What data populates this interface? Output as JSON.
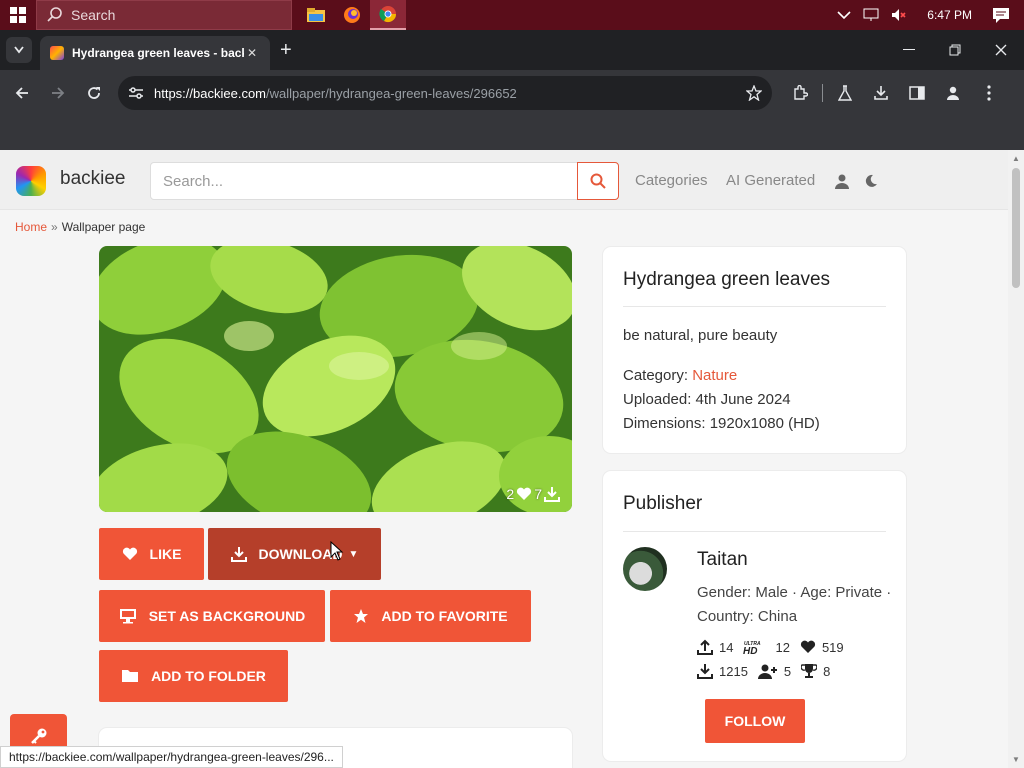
{
  "taskbar": {
    "search_label": "Search",
    "time": "6:47 PM",
    "apps": [
      "file-explorer-icon",
      "firefox-icon",
      "chrome-icon"
    ]
  },
  "browser": {
    "tab_title": "Hydrangea green leaves - backiee",
    "tab_close": "✕",
    "url_host": "https://backiee.com",
    "url_path": "/wallpaper/hydrangea-green-leaves/296652",
    "status_url": "https://backiee.com/wallpaper/hydrangea-green-leaves/296..."
  },
  "site": {
    "logo_text": "backiee",
    "search_placeholder": "Search...",
    "nav": [
      "Categories",
      "AI Generated"
    ],
    "accent_color": "#f05537"
  },
  "breadcrumb": {
    "home": "Home",
    "separator": "»",
    "current": "Wallpaper page"
  },
  "wallpaper": {
    "likes": "2",
    "downloads": "7"
  },
  "actions": {
    "like": "LIKE",
    "download": "DOWNLOAD",
    "set_background": "SET AS BACKGROUND",
    "add_favorite": "ADD TO FAVORITE",
    "add_folder": "ADD TO FOLDER"
  },
  "details": {
    "title": "Hydrangea green leaves",
    "description": "be natural, pure beauty",
    "category_label": "Category:",
    "category_value": "Nature",
    "uploaded": "Uploaded: 4th June 2024",
    "dimensions": "Dimensions: 1920x1080 (HD)"
  },
  "publisher": {
    "heading": "Publisher",
    "name": "Taitan",
    "info": "Gender: Male · Age: Private · Country: China",
    "stats": {
      "uploads": "14",
      "uhd": "12",
      "likes": "519",
      "downloads": "1215",
      "followers": "5",
      "trophies": "8"
    },
    "follow": "FOLLOW"
  }
}
